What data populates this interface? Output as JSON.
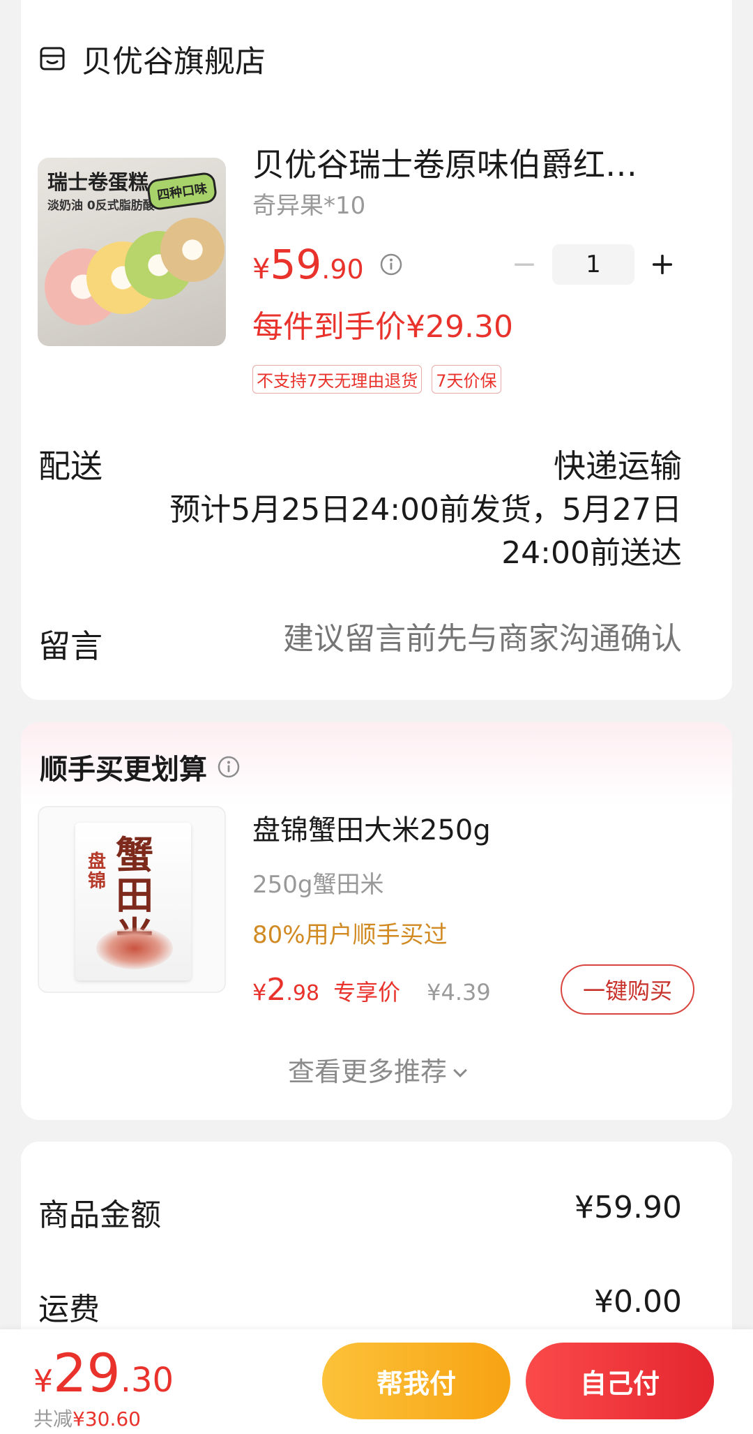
{
  "store": {
    "name": "贝优谷旗舰店",
    "icon": "store-icon"
  },
  "product": {
    "image_title": "瑞士卷蛋糕",
    "image_subtitle": "淡奶油 0反式脂肪酸",
    "image_badge": "四种口味",
    "title": "贝优谷瑞士卷原味伯爵红…",
    "spec": "奇异果*10",
    "price_symbol": "¥",
    "price_int": "59",
    "price_dec": ".90",
    "quantity": "1",
    "deal_price": "每件到手价¥29.30",
    "tags": [
      "不支持7天无理由退货",
      "7天价保"
    ]
  },
  "delivery": {
    "label": "配送",
    "method": "快递运输",
    "time": "预计5月25日24:00前发货，5月27日24:00前送达"
  },
  "message": {
    "label": "留言",
    "placeholder": "建议留言前先与商家沟通确认"
  },
  "recommend": {
    "title": "顺手买更划算",
    "image_brand": "盘锦",
    "image_name": "蟹田米",
    "name": "盘锦蟹田大米250g",
    "spec": "250g蟹田米",
    "popularity": "80%用户顺手买过",
    "price_symbol": "¥",
    "price_int": "2",
    "price_dec": ".98",
    "price_tag": "专享价",
    "original_price": "¥4.39",
    "buy_label": "一键购买",
    "more_label": "查看更多推荐"
  },
  "summary": {
    "goods_label": "商品金额",
    "goods_value": "¥59.90",
    "shipping_label": "运费",
    "shipping_value": "¥0.00"
  },
  "bottom": {
    "total_symbol": "¥",
    "total_int": "29",
    "total_dec": ".30",
    "discount_label": "共减",
    "discount_value": "¥30.60",
    "help_pay_label": "帮我付",
    "self_pay_label": "自己付"
  },
  "colors": {
    "accent_red": "#e8322b",
    "popular_orange": "#d18a22",
    "help_pay_yellow": "#f9b524",
    "self_pay_red": "#ef3238"
  }
}
